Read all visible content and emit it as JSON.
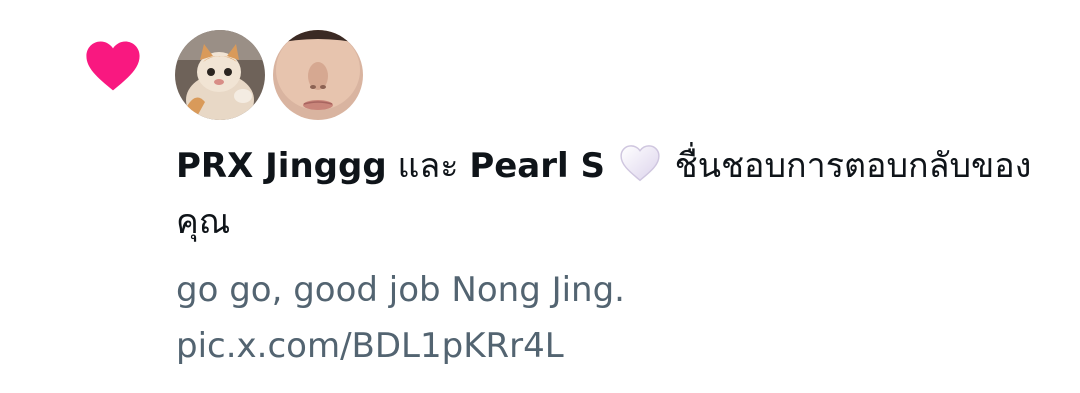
{
  "notification": {
    "type_icon": "heart-icon",
    "icon_color": "#f91880",
    "avatars": [
      {
        "icon": "orange-cat-avatar"
      },
      {
        "icon": "person-face-avatar"
      }
    ],
    "user1": "PRX Jinggg",
    "conjunction": "และ",
    "user2": "Pearl S",
    "user2_emoji": "white-heart-icon",
    "action_text": "ชื่นชอบการตอบกลับของคุณ",
    "snippet": "go go, good job Nong Jing. pic.x.com/BDL1pKRr4L",
    "text_color": "#0f1419",
    "secondary_color": "#536471"
  }
}
